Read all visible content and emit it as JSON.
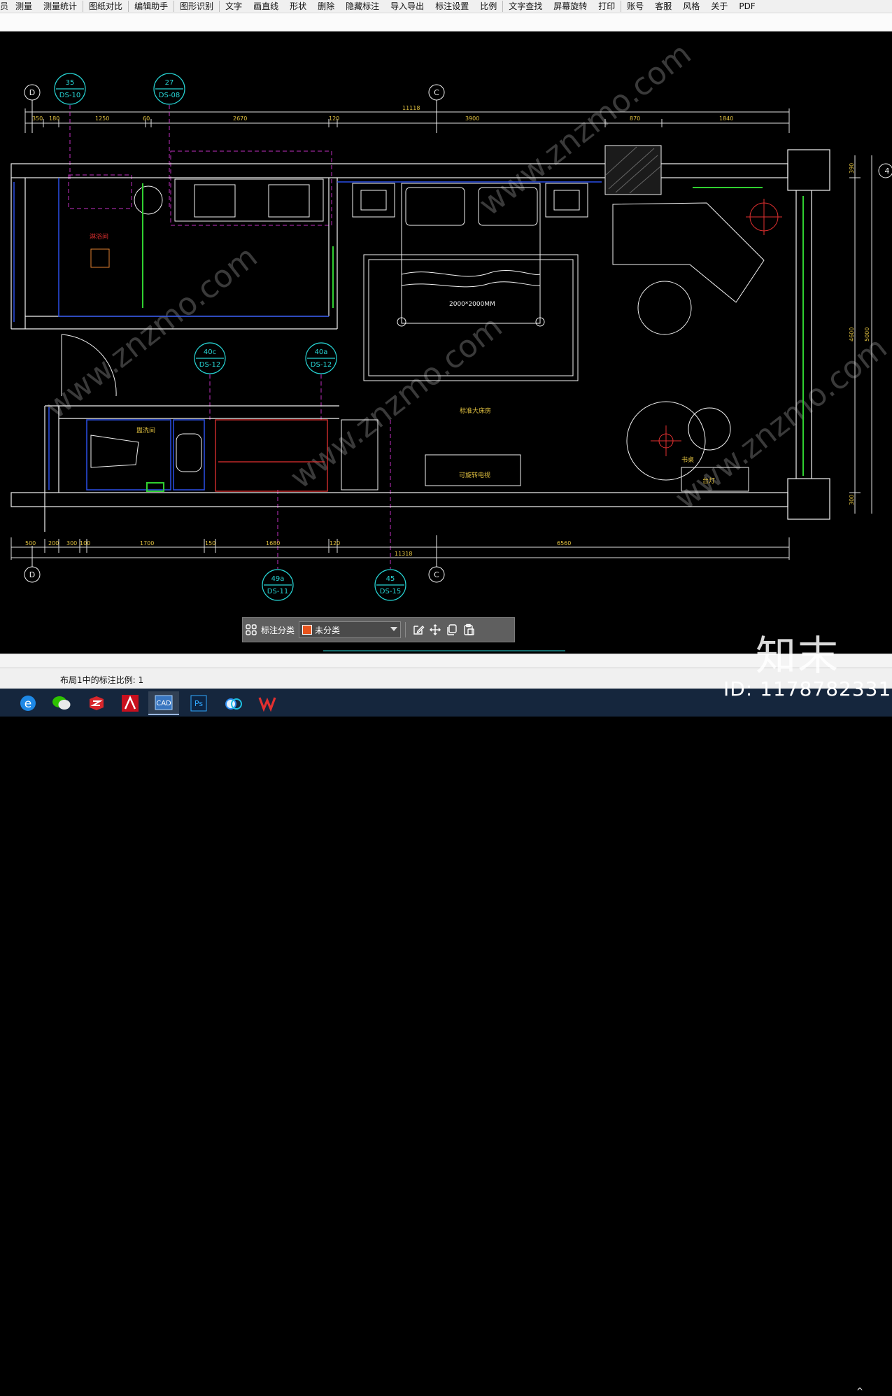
{
  "menu": {
    "items": [
      {
        "label": "员"
      },
      {
        "label": "测量"
      },
      {
        "label": "测量统计"
      },
      {
        "label": "图纸对比"
      },
      {
        "label": "编辑助手"
      },
      {
        "label": "图形识别"
      },
      {
        "label": "文字"
      },
      {
        "label": "画直线"
      },
      {
        "label": "形状"
      },
      {
        "label": "删除"
      },
      {
        "label": "隐藏标注"
      },
      {
        "label": "导入导出"
      },
      {
        "label": "标注设置"
      },
      {
        "label": "比例"
      },
      {
        "label": "文字查找"
      },
      {
        "label": "屏幕旋转"
      },
      {
        "label": "打印"
      },
      {
        "label": "账号"
      },
      {
        "label": "客服"
      },
      {
        "label": "风格"
      },
      {
        "label": "关于"
      },
      {
        "label": "PDF"
      }
    ]
  },
  "drawing": {
    "top_dims": {
      "total": "11118",
      "segments": [
        "350",
        "180",
        "1250",
        "60",
        "2670",
        "120",
        "3900",
        "870",
        "1840"
      ]
    },
    "bottom_dims": {
      "total": "11318",
      "segments": [
        "500",
        "200",
        "300",
        "100",
        "1700",
        "150",
        "1680",
        "120",
        "6560"
      ]
    },
    "right_dims": [
      "390",
      "4600",
      "5000",
      "300"
    ],
    "axis_labels": {
      "d_top": "D",
      "c_top": "C",
      "d_bottom": "D",
      "c_bottom": "C",
      "right": "4"
    },
    "callouts": [
      {
        "num": "35",
        "ref": "DS-10"
      },
      {
        "num": "27",
        "ref": "DS-08"
      },
      {
        "num": "40c",
        "ref": "DS-12"
      },
      {
        "num": "40a",
        "ref": "DS-12"
      },
      {
        "num": "49a",
        "ref": "DS-11"
      },
      {
        "num": "45",
        "ref": "DS-15"
      }
    ],
    "room_labels": {
      "bed_size": "2000*2000MM",
      "standard_room": "标准大床房",
      "tv": "可旋转电视",
      "washroom": "盥洗间",
      "desk": "书桌",
      "lamp": "台灯",
      "shower": "淋浴间"
    },
    "watermark": "www.znzmo.com"
  },
  "floatbar": {
    "label": "标注分类",
    "selected": "未分类",
    "swatch_color": "#e8541d"
  },
  "status": {
    "text": "布局1中的标注比例: 1"
  },
  "taskbar": {
    "apps": [
      {
        "icon": "ie-icon"
      },
      {
        "icon": "wechat-icon"
      },
      {
        "icon": "app-red-icon"
      },
      {
        "icon": "autocad-icon"
      },
      {
        "icon": "cad-viewer-icon"
      },
      {
        "icon": "photoshop-icon"
      },
      {
        "icon": "baidu-netdisk-icon"
      },
      {
        "icon": "wps-icon"
      }
    ]
  },
  "brand": {
    "name": "知末",
    "id": "ID: 1178782331"
  }
}
